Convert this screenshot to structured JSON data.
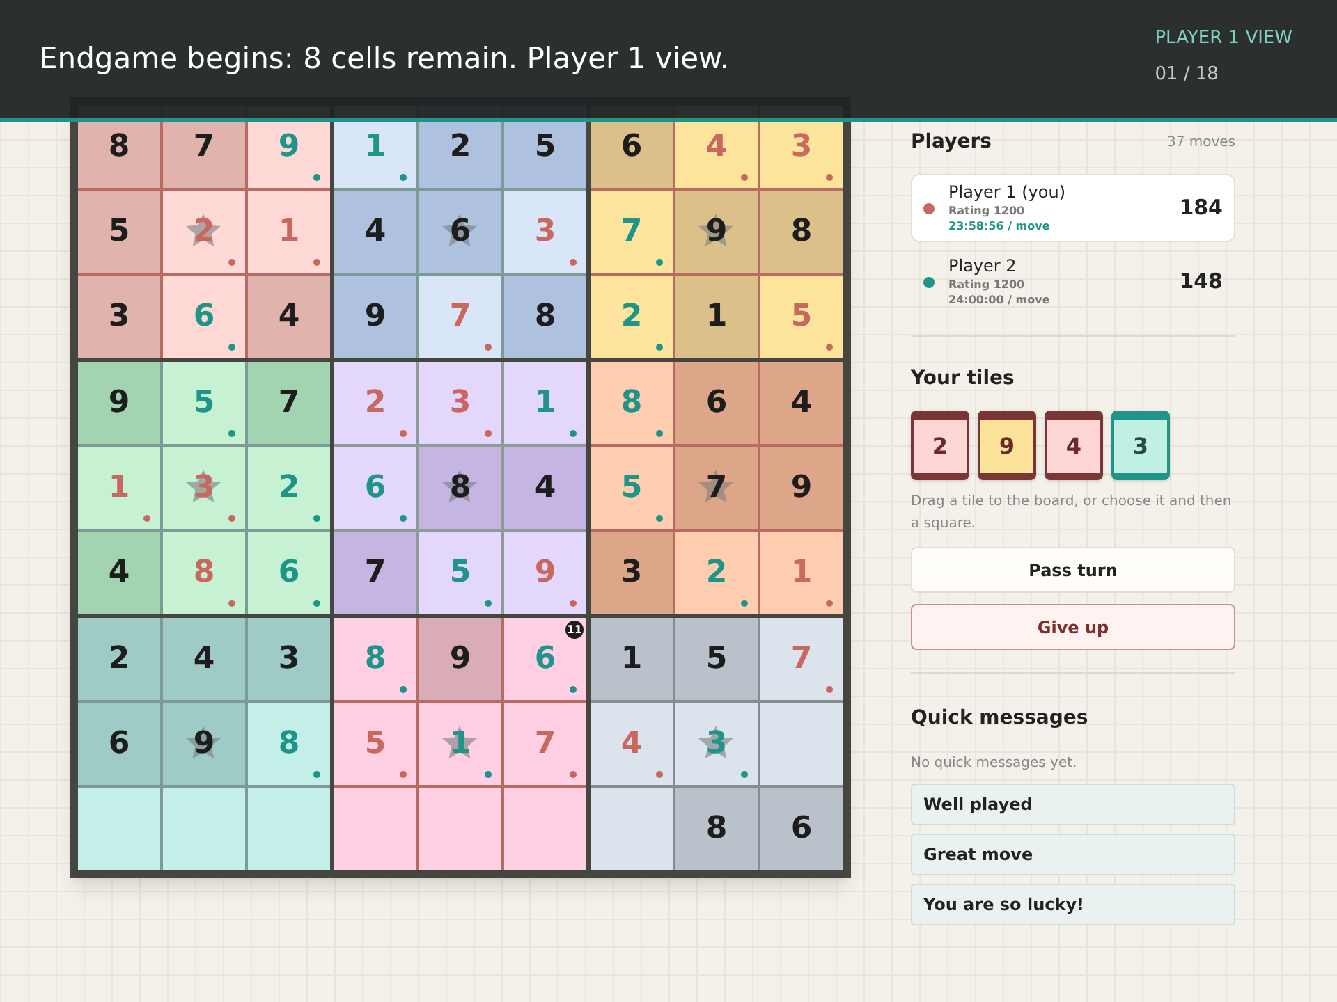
{
  "banner": {
    "message": "Endgame begins: 8 cells remain. Player 1 view.",
    "view": "PLAYER 1 VIEW",
    "step": "01 / 18"
  },
  "board": {
    "rows": [
      [
        {
          "v": "8",
          "kind": "fixed",
          "star": false
        },
        {
          "v": "7",
          "kind": "fixed",
          "star": false
        },
        {
          "v": "9",
          "kind": "p2",
          "star": false
        },
        {
          "v": "1",
          "kind": "p2",
          "star": false
        },
        {
          "v": "2",
          "kind": "fixed",
          "star": false
        },
        {
          "v": "5",
          "kind": "fixed",
          "star": false
        },
        {
          "v": "6",
          "kind": "fixed",
          "star": false
        },
        {
          "v": "4",
          "kind": "p1",
          "star": false
        },
        {
          "v": "3",
          "kind": "p1",
          "star": false
        }
      ],
      [
        {
          "v": "5",
          "kind": "fixed",
          "star": false
        },
        {
          "v": "2",
          "kind": "p1",
          "star": true
        },
        {
          "v": "1",
          "kind": "p1",
          "star": false
        },
        {
          "v": "4",
          "kind": "fixed",
          "star": false
        },
        {
          "v": "6",
          "kind": "fixed",
          "star": true
        },
        {
          "v": "3",
          "kind": "p1",
          "star": false
        },
        {
          "v": "7",
          "kind": "p2",
          "star": false
        },
        {
          "v": "9",
          "kind": "fixed",
          "star": true
        },
        {
          "v": "8",
          "kind": "fixed",
          "star": false
        }
      ],
      [
        {
          "v": "3",
          "kind": "fixed",
          "star": false
        },
        {
          "v": "6",
          "kind": "p2",
          "star": false
        },
        {
          "v": "4",
          "kind": "fixed",
          "star": false
        },
        {
          "v": "9",
          "kind": "fixed",
          "star": false
        },
        {
          "v": "7",
          "kind": "p1",
          "star": false
        },
        {
          "v": "8",
          "kind": "fixed",
          "star": false
        },
        {
          "v": "2",
          "kind": "p2",
          "star": false
        },
        {
          "v": "1",
          "kind": "fixed",
          "star": false
        },
        {
          "v": "5",
          "kind": "p1",
          "star": false
        }
      ],
      [
        {
          "v": "9",
          "kind": "fixed",
          "star": false
        },
        {
          "v": "5",
          "kind": "p2",
          "star": false
        },
        {
          "v": "7",
          "kind": "fixed",
          "star": false
        },
        {
          "v": "2",
          "kind": "p1",
          "star": false
        },
        {
          "v": "3",
          "kind": "p1",
          "star": false
        },
        {
          "v": "1",
          "kind": "p2",
          "star": false
        },
        {
          "v": "8",
          "kind": "p2",
          "star": false
        },
        {
          "v": "6",
          "kind": "fixed",
          "star": false
        },
        {
          "v": "4",
          "kind": "fixed",
          "star": false
        }
      ],
      [
        {
          "v": "1",
          "kind": "p1",
          "star": false
        },
        {
          "v": "3",
          "kind": "p1",
          "star": true
        },
        {
          "v": "2",
          "kind": "p2",
          "star": false
        },
        {
          "v": "6",
          "kind": "p2",
          "star": false
        },
        {
          "v": "8",
          "kind": "fixed",
          "star": true
        },
        {
          "v": "4",
          "kind": "fixed",
          "star": false
        },
        {
          "v": "5",
          "kind": "p2",
          "star": false
        },
        {
          "v": "7",
          "kind": "fixed",
          "star": true
        },
        {
          "v": "9",
          "kind": "fixed",
          "star": false
        }
      ],
      [
        {
          "v": "4",
          "kind": "fixed",
          "star": false
        },
        {
          "v": "8",
          "kind": "p1",
          "star": false
        },
        {
          "v": "6",
          "kind": "p2",
          "star": false
        },
        {
          "v": "7",
          "kind": "fixed",
          "star": false
        },
        {
          "v": "5",
          "kind": "p2",
          "star": false
        },
        {
          "v": "9",
          "kind": "p1",
          "star": false
        },
        {
          "v": "3",
          "kind": "fixed",
          "star": false
        },
        {
          "v": "2",
          "kind": "p2",
          "star": false
        },
        {
          "v": "1",
          "kind": "p1",
          "star": false
        }
      ],
      [
        {
          "v": "2",
          "kind": "fixed",
          "star": false
        },
        {
          "v": "4",
          "kind": "fixed",
          "star": false
        },
        {
          "v": "3",
          "kind": "fixed",
          "star": false
        },
        {
          "v": "8",
          "kind": "p2",
          "star": false
        },
        {
          "v": "9",
          "kind": "fixed",
          "star": false
        },
        {
          "v": "6",
          "kind": "p2",
          "star": false,
          "badge": "11"
        },
        {
          "v": "1",
          "kind": "fixed",
          "star": false
        },
        {
          "v": "5",
          "kind": "fixed",
          "star": false
        },
        {
          "v": "7",
          "kind": "p1",
          "star": false
        }
      ],
      [
        {
          "v": "6",
          "kind": "fixed",
          "star": false
        },
        {
          "v": "9",
          "kind": "fixed",
          "star": true
        },
        {
          "v": "8",
          "kind": "p2",
          "star": false
        },
        {
          "v": "5",
          "kind": "p1",
          "star": false
        },
        {
          "v": "1",
          "kind": "p2",
          "star": true
        },
        {
          "v": "7",
          "kind": "p1",
          "star": false
        },
        {
          "v": "4",
          "kind": "p1",
          "star": false
        },
        {
          "v": "3",
          "kind": "p2",
          "star": true
        },
        {
          "kind": "empty",
          "star": false
        }
      ],
      [
        {
          "kind": "empty",
          "star": false
        },
        {
          "kind": "empty",
          "star": false
        },
        {
          "kind": "empty",
          "star": false
        },
        {
          "kind": "empty",
          "star": false
        },
        {
          "kind": "empty",
          "star": false
        },
        {
          "kind": "empty",
          "star": false
        },
        {
          "kind": "empty",
          "star": false
        },
        {
          "v": "8",
          "kind": "fixed",
          "star": false
        },
        {
          "v": "6",
          "kind": "fixed",
          "star": false
        }
      ]
    ]
  },
  "players": {
    "title": "Players",
    "moves": "37 moves",
    "list": [
      {
        "name": "Player 1 (you)",
        "rating": "Rating 1200",
        "time": "23:58:56 / move",
        "score": "184",
        "color": "#c8685f",
        "selected": true
      },
      {
        "name": "Player 2",
        "rating": "Rating 1200",
        "time": "24:00:00 / move",
        "score": "148",
        "color": "#1f9488",
        "selected": false
      }
    ]
  },
  "tiles": {
    "title": "Your tiles",
    "items": [
      {
        "v": "2",
        "color": "#ffd6d6",
        "kind": "p1"
      },
      {
        "v": "9",
        "color": "#fde39a",
        "kind": "p1"
      },
      {
        "v": "4",
        "color": "#ffd6d6",
        "kind": "p1"
      },
      {
        "v": "3",
        "color": "#bff0e3",
        "kind": "p2"
      }
    ],
    "hint": "Drag a tile to the board, or choose it and then a square."
  },
  "actions": [
    {
      "label": "Pass turn",
      "kind": "neutral"
    },
    {
      "label": "Give up",
      "kind": "danger"
    }
  ],
  "quick_messages": {
    "title": "Quick messages",
    "empty": "No quick messages yet.",
    "items": [
      "Well played",
      "Great move",
      "You are so lucky!"
    ]
  }
}
